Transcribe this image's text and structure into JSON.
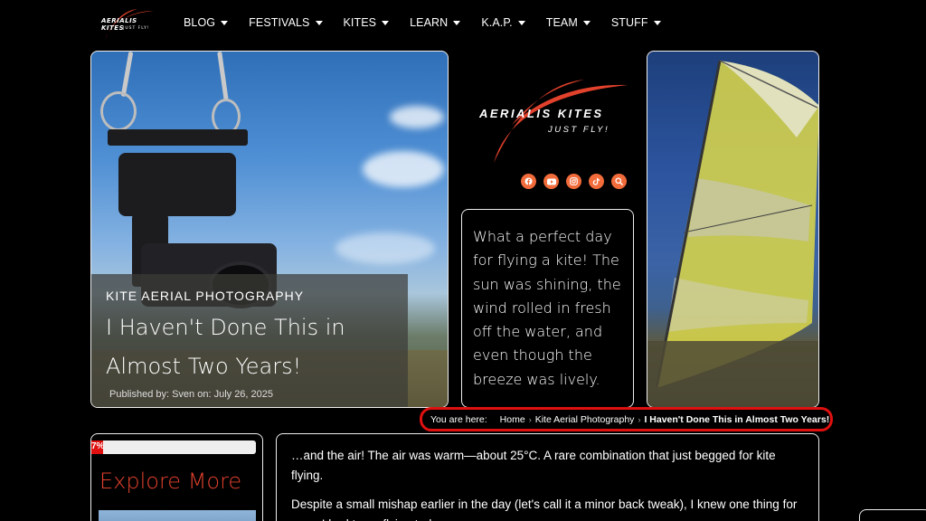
{
  "nav": {
    "logo": {
      "brand": "AERIALIS KITES",
      "tagline": "JUST FLY!"
    },
    "items": [
      {
        "label": "BLOG"
      },
      {
        "label": "FESTIVALS"
      },
      {
        "label": "KITES"
      },
      {
        "label": "LEARN"
      },
      {
        "label": "K.A.P."
      },
      {
        "label": "TEAM"
      },
      {
        "label": "STUFF"
      }
    ]
  },
  "hero": {
    "category": "KITE AERIAL PHOTOGRAPHY",
    "title": "I Haven't Done This in Almost Two Years!",
    "meta": "Published by: Sven  on: July 26, 2025"
  },
  "center": {
    "logo": {
      "brand": "AERIALIS KITES",
      "tagline": "JUST FLY!"
    },
    "socials": [
      "facebook-icon",
      "youtube-icon",
      "instagram-icon",
      "tiktok-icon",
      "search-icon"
    ],
    "quote": "What a perfect day for flying a kite! The sun was shining, the wind rolled in fresh off the water, and even though the breeze was lively."
  },
  "breadcrumb": {
    "label": "You are here:",
    "items": [
      "Home",
      "Kite Aerial Photography"
    ],
    "current": "I Haven't Done This in Almost Two Years!"
  },
  "sidebar": {
    "progress": {
      "label": "7%",
      "value": 0.07
    },
    "heading": "Explore More"
  },
  "article": {
    "paragraphs": [
      "…and the air! The air was warm—about 25°C. A rare combination that just begged for kite flying.",
      "Despite a small mishap earlier in the day (let's call it a minor back tweak), I knew one thing for sure: I had to go flying today."
    ]
  },
  "colors": {
    "accent": "#f26b3a",
    "highlight": "#e01010",
    "heading": "#e2412c",
    "background": "#000000"
  }
}
